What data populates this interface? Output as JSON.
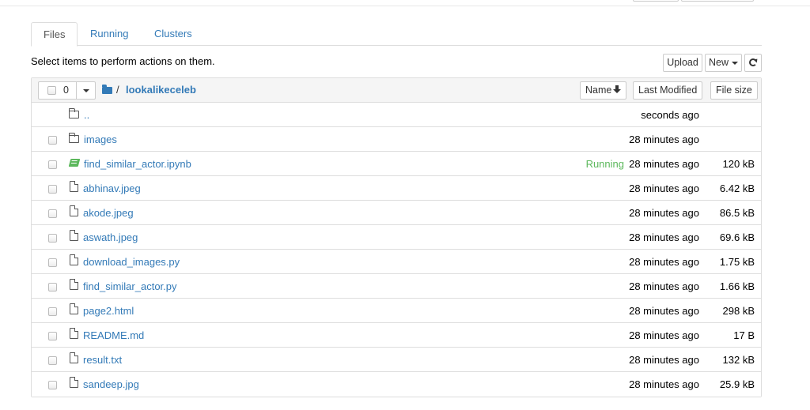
{
  "tabs": [
    {
      "label": "Files"
    },
    {
      "label": "Running"
    },
    {
      "label": "Clusters"
    }
  ],
  "toolbar": {
    "select_message": "Select items to perform actions on them.",
    "upload_label": "Upload",
    "new_label": "New"
  },
  "list_header": {
    "selected_count": "0",
    "separator": "/",
    "folder_name": "lookalikeceleb",
    "sort_name_label": "Name",
    "sort_modified_label": "Last Modified",
    "sort_size_label": "File size"
  },
  "files": [
    {
      "type": "parent",
      "name": "..",
      "modified": "seconds ago",
      "size": "",
      "status": ""
    },
    {
      "type": "folder",
      "name": "images",
      "modified": "28 minutes ago",
      "size": "",
      "status": ""
    },
    {
      "type": "notebook",
      "name": "find_similar_actor.ipynb",
      "modified": "28 minutes ago",
      "size": "120 kB",
      "status": "Running"
    },
    {
      "type": "file",
      "name": "abhinav.jpeg",
      "modified": "28 minutes ago",
      "size": "6.42 kB",
      "status": ""
    },
    {
      "type": "file",
      "name": "akode.jpeg",
      "modified": "28 minutes ago",
      "size": "86.5 kB",
      "status": ""
    },
    {
      "type": "file",
      "name": "aswath.jpeg",
      "modified": "28 minutes ago",
      "size": "69.6 kB",
      "status": ""
    },
    {
      "type": "file",
      "name": "download_images.py",
      "modified": "28 minutes ago",
      "size": "1.75 kB",
      "status": ""
    },
    {
      "type": "file",
      "name": "find_similar_actor.py",
      "modified": "28 minutes ago",
      "size": "1.66 kB",
      "status": ""
    },
    {
      "type": "file",
      "name": "page2.html",
      "modified": "28 minutes ago",
      "size": "298 kB",
      "status": ""
    },
    {
      "type": "file",
      "name": "README.md",
      "modified": "28 minutes ago",
      "size": "17 B",
      "status": ""
    },
    {
      "type": "file",
      "name": "result.txt",
      "modified": "28 minutes ago",
      "size": "132 kB",
      "status": ""
    },
    {
      "type": "file",
      "name": "sandeep.jpg",
      "modified": "28 minutes ago",
      "size": "25.9 kB",
      "status": ""
    }
  ],
  "colors": {
    "link": "#337ab7",
    "running": "#5cb85c",
    "border": "#dddddd",
    "header_bg": "#f5f5f5"
  },
  "icons": {
    "folder": "folder-icon",
    "file": "file-icon",
    "notebook": "notebook-icon",
    "refresh": "refresh-icon",
    "sort": "arrow-down-icon"
  }
}
